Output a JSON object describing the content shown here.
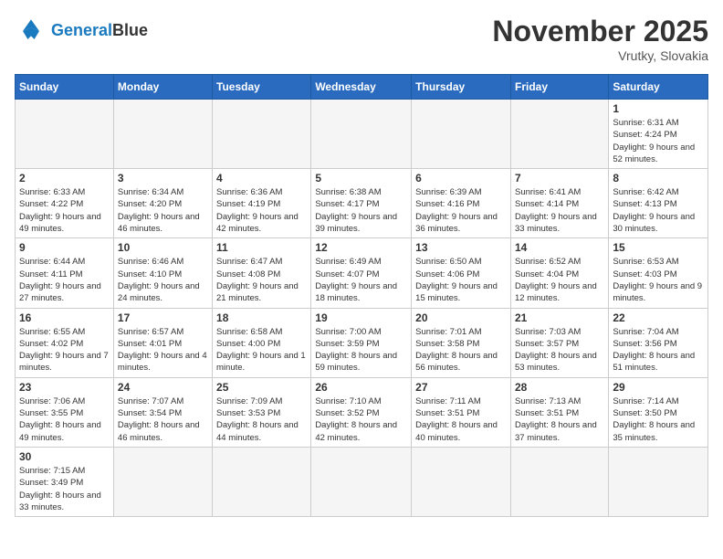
{
  "header": {
    "logo_general": "General",
    "logo_blue": "Blue",
    "month_year": "November 2025",
    "location": "Vrutky, Slovakia"
  },
  "weekdays": [
    "Sunday",
    "Monday",
    "Tuesday",
    "Wednesday",
    "Thursday",
    "Friday",
    "Saturday"
  ],
  "weeks": [
    [
      {
        "day": "",
        "info": ""
      },
      {
        "day": "",
        "info": ""
      },
      {
        "day": "",
        "info": ""
      },
      {
        "day": "",
        "info": ""
      },
      {
        "day": "",
        "info": ""
      },
      {
        "day": "",
        "info": ""
      },
      {
        "day": "1",
        "info": "Sunrise: 6:31 AM\nSunset: 4:24 PM\nDaylight: 9 hours\nand 52 minutes."
      }
    ],
    [
      {
        "day": "2",
        "info": "Sunrise: 6:33 AM\nSunset: 4:22 PM\nDaylight: 9 hours\nand 49 minutes."
      },
      {
        "day": "3",
        "info": "Sunrise: 6:34 AM\nSunset: 4:20 PM\nDaylight: 9 hours\nand 46 minutes."
      },
      {
        "day": "4",
        "info": "Sunrise: 6:36 AM\nSunset: 4:19 PM\nDaylight: 9 hours\nand 42 minutes."
      },
      {
        "day": "5",
        "info": "Sunrise: 6:38 AM\nSunset: 4:17 PM\nDaylight: 9 hours\nand 39 minutes."
      },
      {
        "day": "6",
        "info": "Sunrise: 6:39 AM\nSunset: 4:16 PM\nDaylight: 9 hours\nand 36 minutes."
      },
      {
        "day": "7",
        "info": "Sunrise: 6:41 AM\nSunset: 4:14 PM\nDaylight: 9 hours\nand 33 minutes."
      },
      {
        "day": "8",
        "info": "Sunrise: 6:42 AM\nSunset: 4:13 PM\nDaylight: 9 hours\nand 30 minutes."
      }
    ],
    [
      {
        "day": "9",
        "info": "Sunrise: 6:44 AM\nSunset: 4:11 PM\nDaylight: 9 hours\nand 27 minutes."
      },
      {
        "day": "10",
        "info": "Sunrise: 6:46 AM\nSunset: 4:10 PM\nDaylight: 9 hours\nand 24 minutes."
      },
      {
        "day": "11",
        "info": "Sunrise: 6:47 AM\nSunset: 4:08 PM\nDaylight: 9 hours\nand 21 minutes."
      },
      {
        "day": "12",
        "info": "Sunrise: 6:49 AM\nSunset: 4:07 PM\nDaylight: 9 hours\nand 18 minutes."
      },
      {
        "day": "13",
        "info": "Sunrise: 6:50 AM\nSunset: 4:06 PM\nDaylight: 9 hours\nand 15 minutes."
      },
      {
        "day": "14",
        "info": "Sunrise: 6:52 AM\nSunset: 4:04 PM\nDaylight: 9 hours\nand 12 minutes."
      },
      {
        "day": "15",
        "info": "Sunrise: 6:53 AM\nSunset: 4:03 PM\nDaylight: 9 hours\nand 9 minutes."
      }
    ],
    [
      {
        "day": "16",
        "info": "Sunrise: 6:55 AM\nSunset: 4:02 PM\nDaylight: 9 hours\nand 7 minutes."
      },
      {
        "day": "17",
        "info": "Sunrise: 6:57 AM\nSunset: 4:01 PM\nDaylight: 9 hours\nand 4 minutes."
      },
      {
        "day": "18",
        "info": "Sunrise: 6:58 AM\nSunset: 4:00 PM\nDaylight: 9 hours\nand 1 minute."
      },
      {
        "day": "19",
        "info": "Sunrise: 7:00 AM\nSunset: 3:59 PM\nDaylight: 8 hours\nand 59 minutes."
      },
      {
        "day": "20",
        "info": "Sunrise: 7:01 AM\nSunset: 3:58 PM\nDaylight: 8 hours\nand 56 minutes."
      },
      {
        "day": "21",
        "info": "Sunrise: 7:03 AM\nSunset: 3:57 PM\nDaylight: 8 hours\nand 53 minutes."
      },
      {
        "day": "22",
        "info": "Sunrise: 7:04 AM\nSunset: 3:56 PM\nDaylight: 8 hours\nand 51 minutes."
      }
    ],
    [
      {
        "day": "23",
        "info": "Sunrise: 7:06 AM\nSunset: 3:55 PM\nDaylight: 8 hours\nand 49 minutes."
      },
      {
        "day": "24",
        "info": "Sunrise: 7:07 AM\nSunset: 3:54 PM\nDaylight: 8 hours\nand 46 minutes."
      },
      {
        "day": "25",
        "info": "Sunrise: 7:09 AM\nSunset: 3:53 PM\nDaylight: 8 hours\nand 44 minutes."
      },
      {
        "day": "26",
        "info": "Sunrise: 7:10 AM\nSunset: 3:52 PM\nDaylight: 8 hours\nand 42 minutes."
      },
      {
        "day": "27",
        "info": "Sunrise: 7:11 AM\nSunset: 3:51 PM\nDaylight: 8 hours\nand 40 minutes."
      },
      {
        "day": "28",
        "info": "Sunrise: 7:13 AM\nSunset: 3:51 PM\nDaylight: 8 hours\nand 37 minutes."
      },
      {
        "day": "29",
        "info": "Sunrise: 7:14 AM\nSunset: 3:50 PM\nDaylight: 8 hours\nand 35 minutes."
      }
    ],
    [
      {
        "day": "30",
        "info": "Sunrise: 7:15 AM\nSunset: 3:49 PM\nDaylight: 8 hours\nand 33 minutes."
      },
      {
        "day": "",
        "info": ""
      },
      {
        "day": "",
        "info": ""
      },
      {
        "day": "",
        "info": ""
      },
      {
        "day": "",
        "info": ""
      },
      {
        "day": "",
        "info": ""
      },
      {
        "day": "",
        "info": ""
      }
    ]
  ]
}
